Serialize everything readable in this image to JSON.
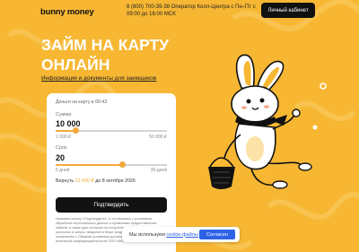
{
  "header": {
    "logo": "bunny money",
    "contact": "8 (800) 700-39-38 Оператор Колл-Центра с Пн–Пт с 09:00 до 16:00 МСК",
    "cabinet_button": "Личный кабинет"
  },
  "hero": {
    "title_line1": "ЗАЙМ НА КАРТУ",
    "title_line2": "ОНЛАЙН",
    "docs_link": "Информация и документы для заемщиков"
  },
  "form": {
    "eta": "Деньги на карту в 00:43",
    "amount_label": "Сумма",
    "amount_value": "10 000",
    "amount_progress": 0.184,
    "amount_min": "1 000 ₽",
    "amount_max": "50 000 ₽",
    "term_label": "Срок",
    "term_value": "20",
    "term_progress": 0.6,
    "term_min": "5 дней",
    "term_max": "30 дней",
    "return_prefix": "Вернуть",
    "return_amount": "13 000 ₽",
    "return_suffix": "до 8 октября 2026",
    "confirm_button": "Подтвердить",
    "legal_lines": [
      "Нажимая кнопку «Подтвердить», я соглашаюсь с условиями",
      "обработки персональных данных и правилами предоставления",
      "займов, а также даю согласие на получение информационных",
      "рассылок и запрос сведений в бюро кредитных историй,",
      "ознакомлен с Общими условиями договора займа и",
      "политикой конфиденциальности ООО МКК «Банни Мани»."
    ]
  },
  "cookie": {
    "text_prefix": "Мы используем",
    "link": "cookie-файлы",
    "button": "Согласен"
  },
  "colors": {
    "background": "#F7B733",
    "accent": "#F2A93B",
    "dark": "#111111",
    "link": "#2D62E6"
  }
}
